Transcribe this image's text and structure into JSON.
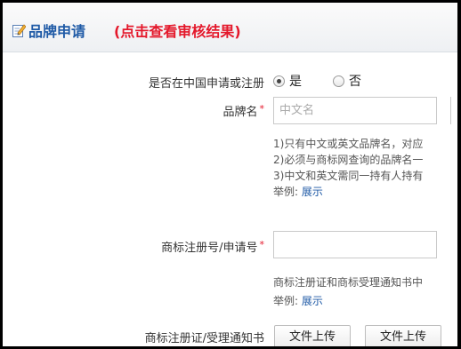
{
  "header": {
    "title": "品牌申请",
    "subtitle": "(点击查看审核结果)",
    "icon": "edit-icon"
  },
  "form": {
    "registered_in_china": {
      "label": "是否在中国申请或注册",
      "options": [
        "是",
        "否"
      ],
      "selected": "是"
    },
    "brand_name": {
      "label": "品牌名",
      "required_mark": "*",
      "placeholder": "中文名",
      "notes": [
        "1)只有中文或英文品牌名，对应",
        "2)必须与商标网查询的品牌名一",
        "3)中文和英文需同一持有人持有"
      ],
      "example_prefix": "举例:",
      "example_link": "展示"
    },
    "trademark_number": {
      "label": "商标注册号/申请号",
      "required_mark": "*",
      "value": "",
      "note": "商标注册证和商标受理通知书中",
      "example_prefix": "举例:",
      "example_link": "展示"
    },
    "certificate": {
      "label": "商标注册证/受理通知书",
      "buttons": [
        "文件上传",
        "文件上传"
      ]
    }
  },
  "colors": {
    "title": "#1f5aa6",
    "subtitle": "#e4182b",
    "required": "#e4182b",
    "link": "#1f5aa6"
  }
}
